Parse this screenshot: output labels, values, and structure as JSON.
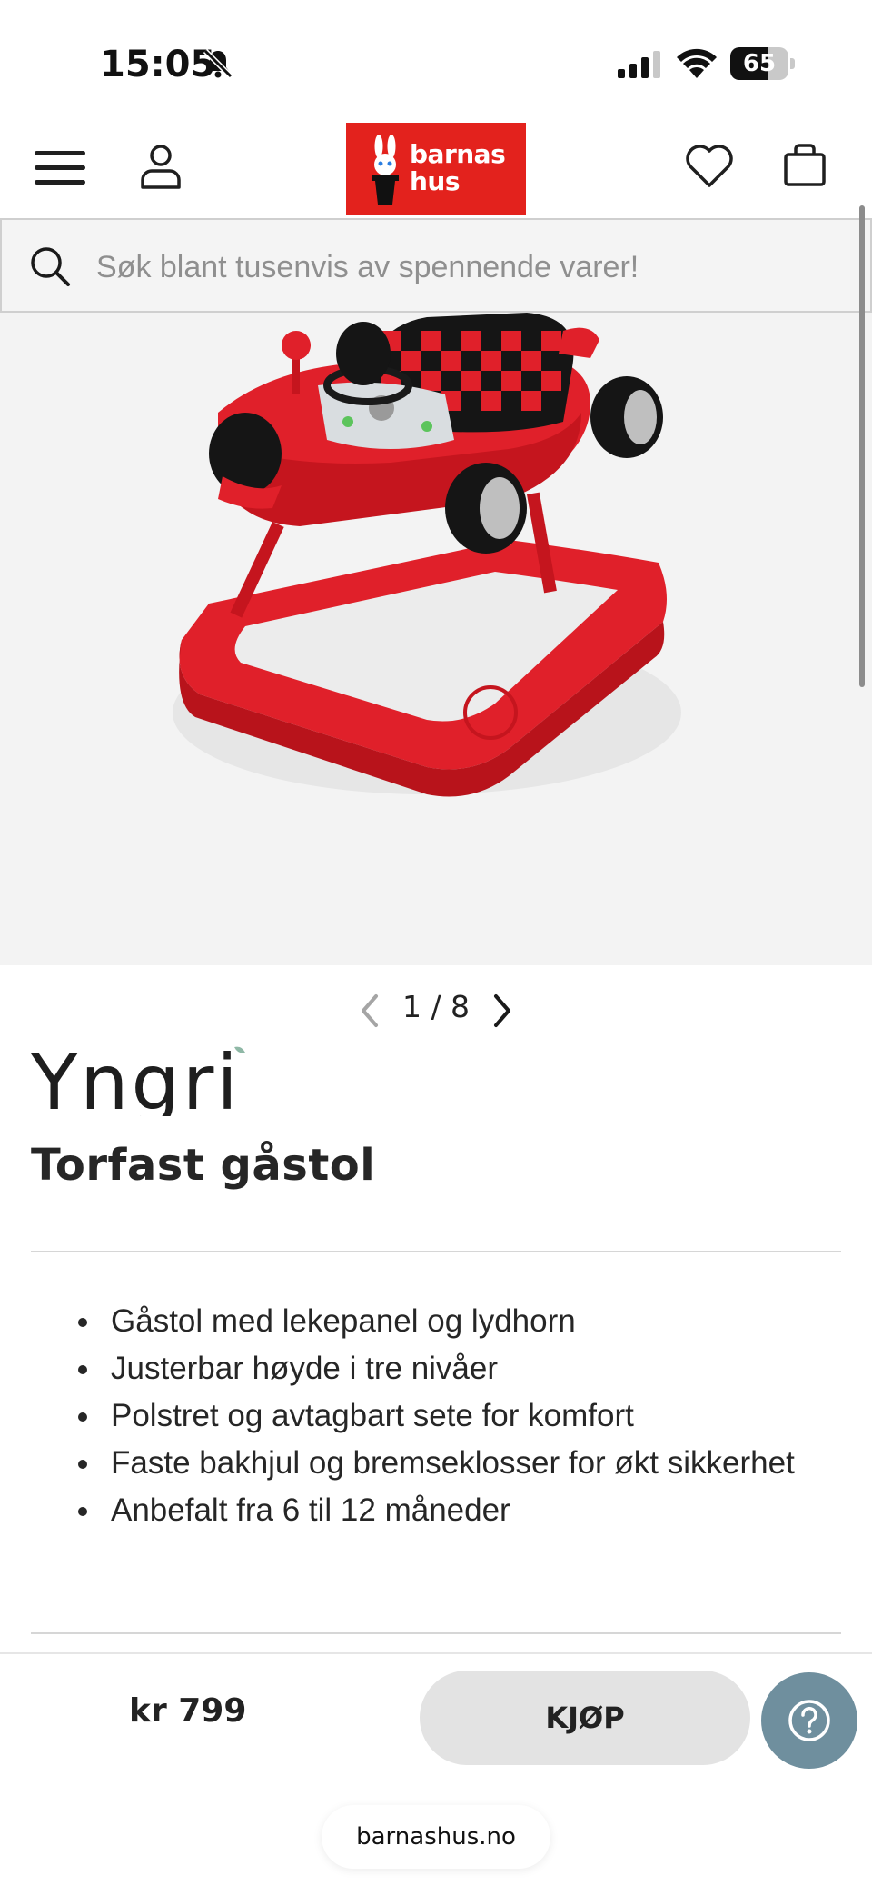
{
  "status_bar": {
    "time": "15:05",
    "battery": "65",
    "battery_level": 0.65,
    "icons": [
      "bell-off-icon",
      "signal-icon",
      "wifi-icon",
      "battery-icon"
    ]
  },
  "header": {
    "logo": {
      "line1": "barnas",
      "line2": "hus"
    },
    "icons": [
      "menu-icon",
      "user-icon",
      "heart-icon",
      "bag-icon"
    ]
  },
  "search": {
    "placeholder": "Søk blant tusenvis av spennende varer!"
  },
  "gallery": {
    "pager": "1 / 8"
  },
  "product": {
    "brand": "Yngri",
    "title": "Torfast gåstol",
    "features": [
      "Gåstol med lekepanel og lydhorn",
      "Justerbar høyde i tre nivåer",
      "Polstret og avtagbart sete for komfort",
      "Faste bakhjul og bremseklosser for økt sikkerhet",
      "Anbefalt fra 6 til 12 måneder"
    ]
  },
  "buy_bar": {
    "price": "kr 799",
    "buy_label": "KJØP"
  },
  "browser": {
    "url": "barnashus.no"
  },
  "colors": {
    "brand_red": "#e3221d",
    "walker_red": "#e0202a",
    "help_button": "#6f8f9e",
    "buy_button": "#e3e3e3"
  }
}
